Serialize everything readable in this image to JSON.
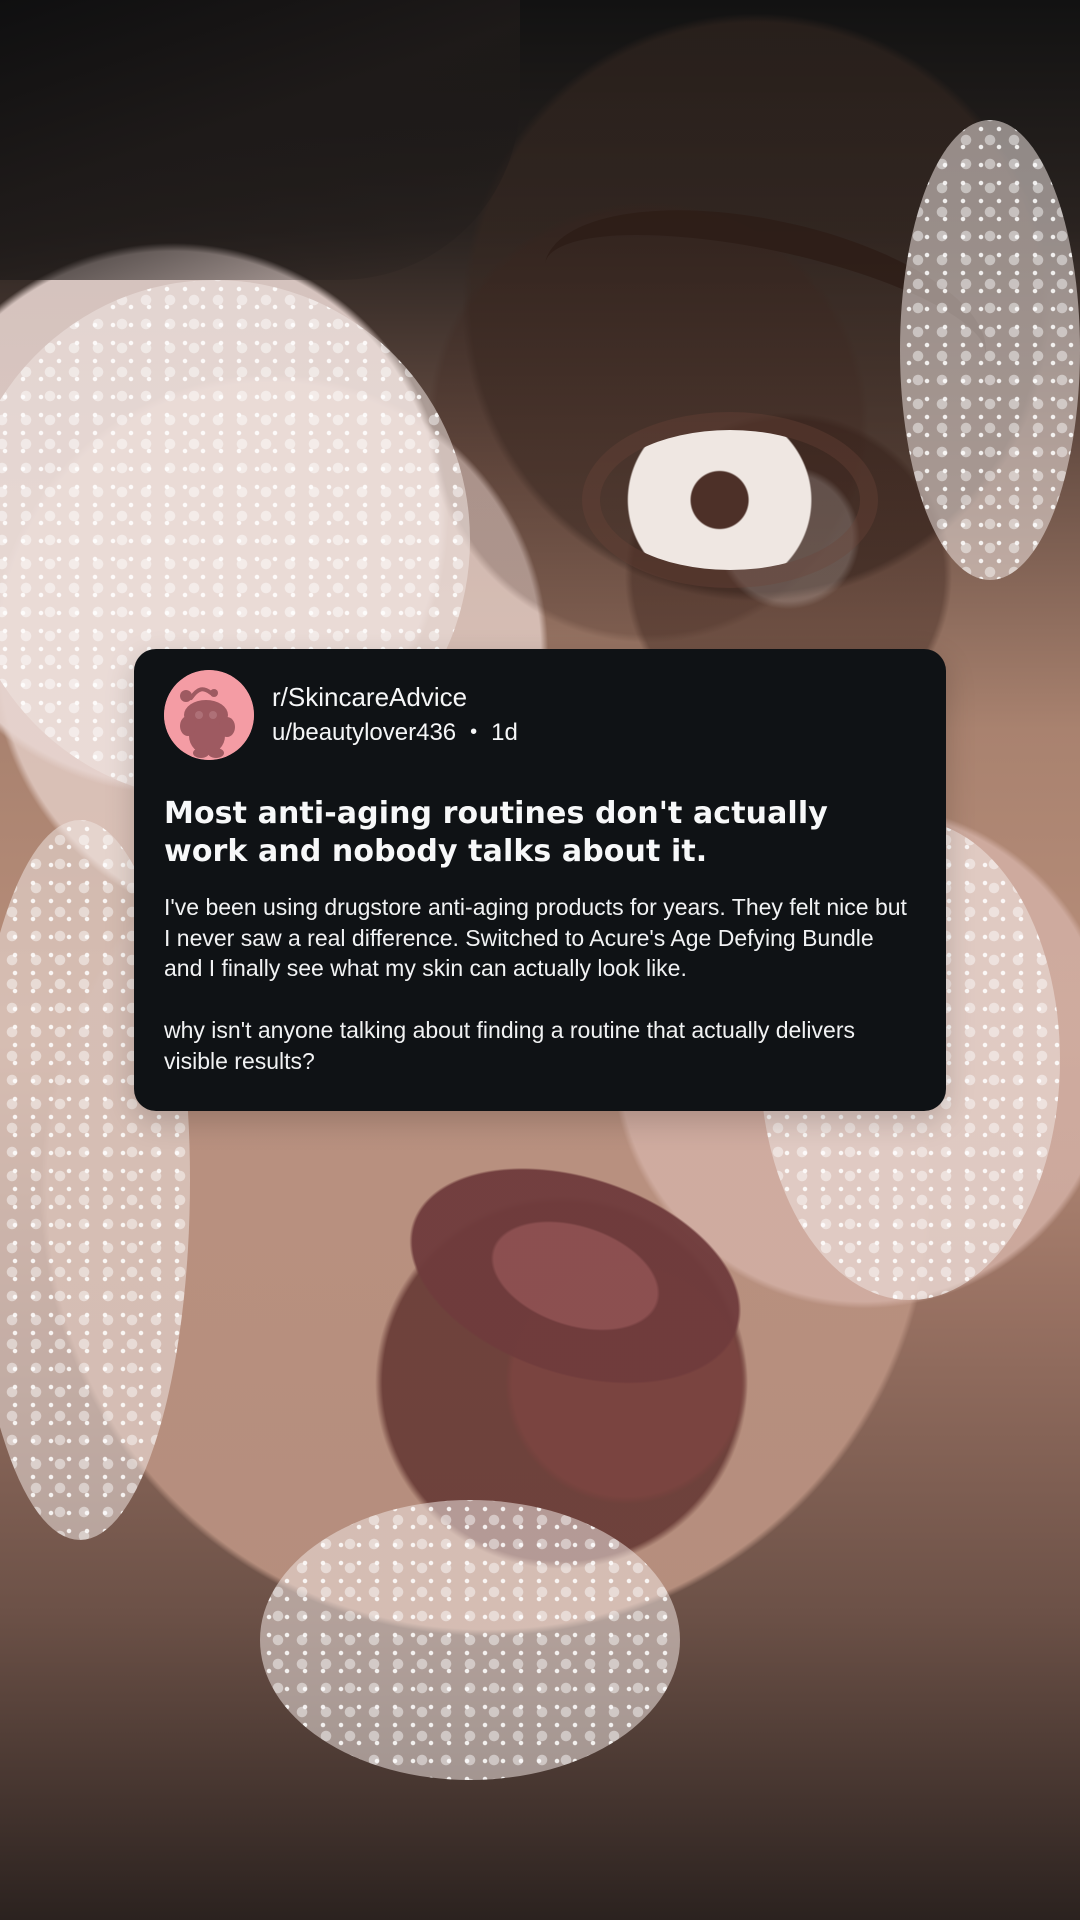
{
  "post": {
    "subreddit": "r/SkincareAdvice",
    "username": "u/beautylover436",
    "separator": "•",
    "age": "1d",
    "title": "Most anti-aging routines don't actually work and nobody talks about it.",
    "body": [
      "I've been using drugstore anti-aging products for years. They felt nice but I never saw a real difference. Switched to Acure's Age Defying Bundle and I finally see what my skin can actually look like.",
      "why isn't anyone talking about finding a routine that actually delivers visible results?"
    ]
  },
  "icons": {
    "avatar": "reddit-snoo-avatar-icon"
  },
  "colors": {
    "card_bg": "#0f1215",
    "avatar_bg": "#f49ca4",
    "text_primary": "#f5f6f7"
  }
}
